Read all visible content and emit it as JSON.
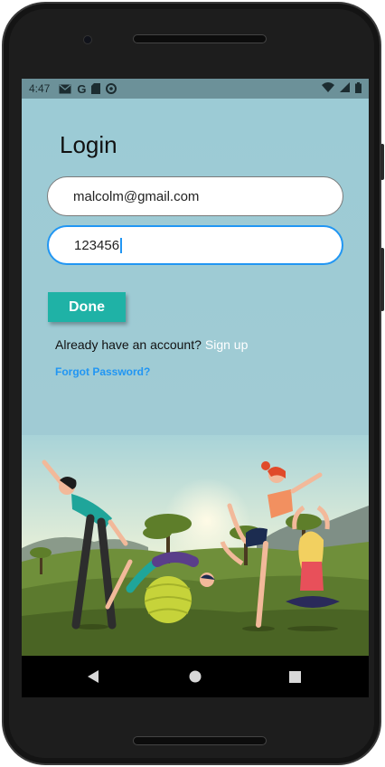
{
  "status_bar": {
    "time": "4:47",
    "icons": [
      "mail-icon",
      "google-icon",
      "sd-card-icon",
      "sync-icon"
    ],
    "right_icons": [
      "wifi-icon",
      "signal-icon",
      "battery-icon"
    ]
  },
  "login": {
    "title": "Login",
    "email_value": "malcolm@gmail.com",
    "password_value": "123456",
    "done_label": "Done",
    "have_account_text": "Already have an account?",
    "signup_label": "Sign up",
    "forgot_label": "Forgot Password?"
  },
  "nav_bar": {
    "icons": [
      "back-icon",
      "home-icon",
      "recents-icon"
    ]
  },
  "colors": {
    "accent": "#1fb2a6",
    "link": "#2196f3",
    "background": "#9ecbd4",
    "status_bar": "#6c9199"
  }
}
